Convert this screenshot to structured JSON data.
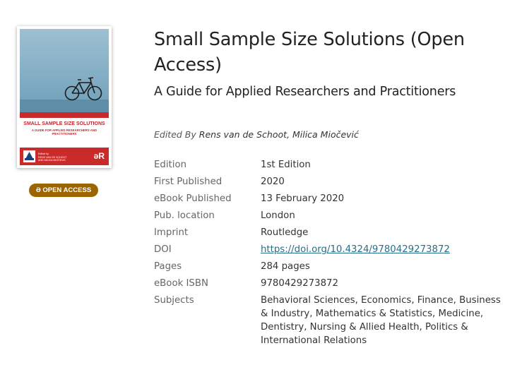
{
  "cover": {
    "title": "SMALL SAMPLE SIZE SOLUTIONS",
    "subtitle": "A GUIDE FOR APPLIED RESEARCHERS AND PRACTITIONERS",
    "editors_line1": "Edited by",
    "editors_line2": "RENS VAN DE SCHOOT",
    "editors_line3": "AND MILICA MIOČEVIĆ",
    "publisher_mark": "əR",
    "colors": {
      "sky": "#8fb7cc",
      "brand_red": "#c92a2a"
    }
  },
  "badge": {
    "label": "Ə OPEN ACCESS",
    "color": "#9b6500"
  },
  "book": {
    "title": "Small Sample Size Solutions (Open Access)",
    "subtitle": "A Guide for Applied Researchers and Practitioners",
    "edited_by_label": "Edited By",
    "editors": "Rens van de Schoot, Milica Miočević"
  },
  "details": [
    {
      "label": "Edition",
      "value": "1st Edition"
    },
    {
      "label": "First Published",
      "value": "2020"
    },
    {
      "label": "eBook Published",
      "value": "13 February 2020"
    },
    {
      "label": "Pub. location",
      "value": "London"
    },
    {
      "label": "Imprint",
      "value": "Routledge"
    },
    {
      "label": "DOI",
      "value": "https://doi.org/10.4324/9780429273872"
    },
    {
      "label": "Pages",
      "value": "284 pages"
    },
    {
      "label": "eBook ISBN",
      "value": "9780429273872"
    },
    {
      "label": "Subjects",
      "value": "Behavioral Sciences, Economics, Finance, Business & Industry, Mathematics & Statistics, Medicine, Dentistry, Nursing & Allied Health, Politics & International Relations"
    }
  ],
  "colors": {
    "link": "#266f8a",
    "label_text": "#666666",
    "body_text": "#333333"
  }
}
